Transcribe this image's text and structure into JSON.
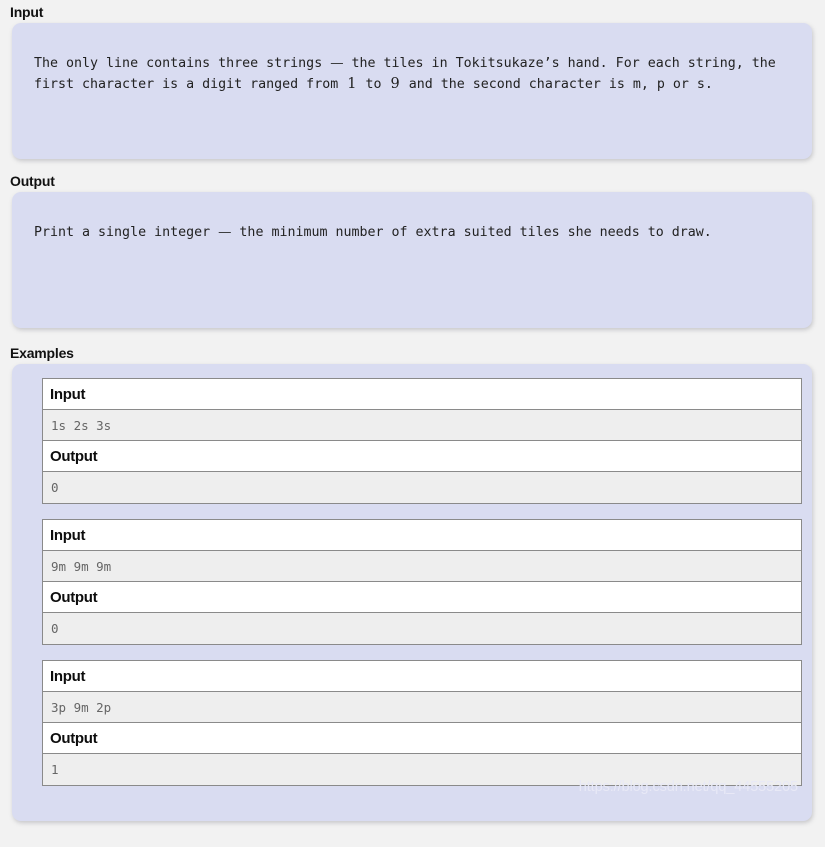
{
  "sections": {
    "input": {
      "title": "Input",
      "body_prefix": "The only line contains three strings  ",
      "body_dash": "—",
      "body_mid": " the tiles in Tokitsukaze’s hand. For each string, the first character is a digit ranged from ",
      "num_low": "1",
      "body_between": " to ",
      "num_high": "9",
      "body_suffix": " and the second character is m, p or s."
    },
    "output": {
      "title": "Output",
      "body_prefix": "Print a single integer  ",
      "body_dash": "—",
      "body_suffix": " the minimum number of extra suited tiles she needs to draw."
    },
    "examples": {
      "title": "Examples",
      "input_label": "Input",
      "output_label": "Output",
      "cases": [
        {
          "input": "1s 2s 3s",
          "output": "0"
        },
        {
          "input": "9m 9m 9m",
          "output": "0"
        },
        {
          "input": "3p 9m 2p",
          "output": "1"
        }
      ]
    }
  },
  "watermark": "https://blog.csdn.net/qq_44555205",
  "colors": {
    "page_background": "#f2f2f2",
    "panel_background": "#d9dcf1",
    "table_header_background": "#ffffff",
    "table_data_background": "#eeeeee",
    "table_border": "#8a8a8a",
    "body_text": "#222222",
    "data_text": "#666666",
    "watermark_text": "#e8e9f6"
  }
}
